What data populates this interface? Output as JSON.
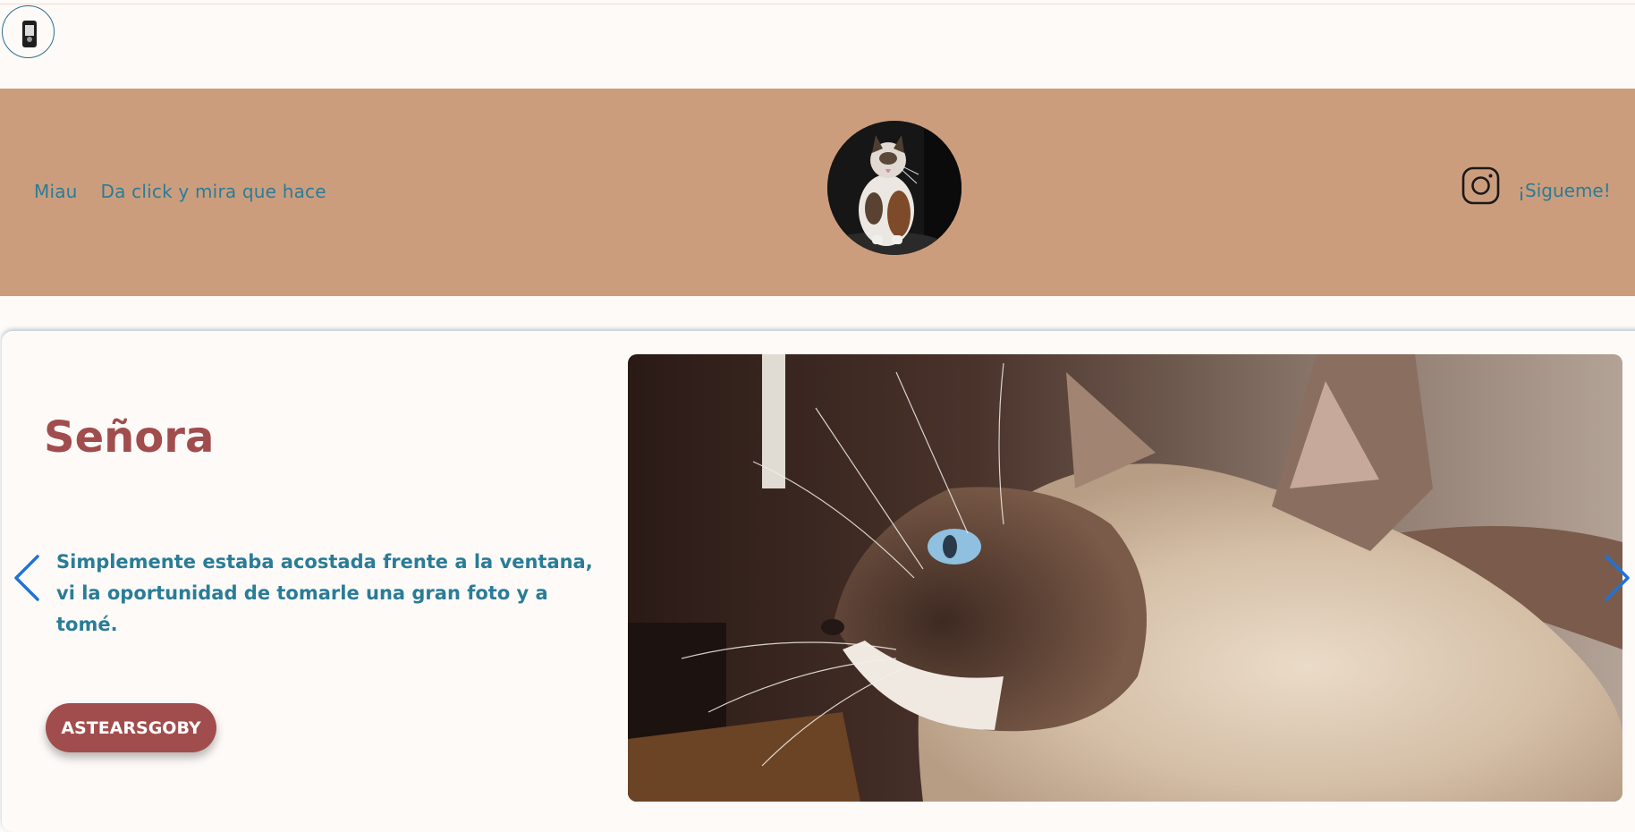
{
  "nav": {
    "items": [
      {
        "label": "Miau"
      },
      {
        "label": "Da click y mira que hace"
      }
    ]
  },
  "header": {
    "background_color": "#cc9d7d",
    "social": {
      "icon": "instagram-icon",
      "label": "¡Sigueme!"
    }
  },
  "slide": {
    "title": "Señora",
    "description": "Simplemente estaba acostada frente a la ventana, vi la oportunidad de tomarle una gran foto y a tomé.",
    "button_label": "ASTEARSGOBY"
  },
  "carousel": {
    "prev_icon": "chevron-left-icon",
    "next_icon": "chevron-right-icon"
  },
  "colors": {
    "accent_text": "#2a7c97",
    "title_red": "#a24d4d",
    "page_bg": "#fdfaf8"
  }
}
